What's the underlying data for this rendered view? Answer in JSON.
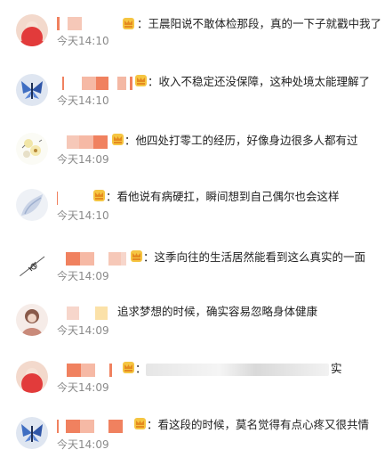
{
  "comments": [
    {
      "text": "：王晨阳说不敢体检那段，真的一下子就戳中我了",
      "time": "今天14:10",
      "avatar": "red-circle-avatar"
    },
    {
      "text": "：收入不稳定还没保障，这种处境太能理解了",
      "time": "今天14:10",
      "avatar": "blue-butterfly-avatar"
    },
    {
      "text": "：他四处打零工的经历，好像身边很多人都有过",
      "time": "今天14:09",
      "avatar": "flower-avatar"
    },
    {
      "text": "：看他说有病硬扛，瞬间想到自己偶尔也会这样",
      "time": "今天14:10",
      "avatar": "blue-figure-avatar"
    },
    {
      "text": "：这季向往的生活居然能看到这么真实的一面",
      "time": "今天14:09",
      "avatar": "sketch-avatar"
    },
    {
      "text": "追求梦想的时候，确实容易忽略身体健康",
      "time": "今天14:09",
      "avatar": "girl-avatar"
    },
    {
      "text": "：",
      "text_end": "实",
      "time": "今天14:09",
      "avatar": "red-circle-avatar"
    },
    {
      "text": "：看这段的时候，莫名觉得有点心疼又很共情",
      "time": "今天14:09",
      "avatar": "blue-butterfly-avatar"
    }
  ],
  "colors": {
    "accent_orange": "#f0815f",
    "accent_pink": "#f6b9a5",
    "crown": "#f5c542",
    "time": "#8a8a8a"
  }
}
